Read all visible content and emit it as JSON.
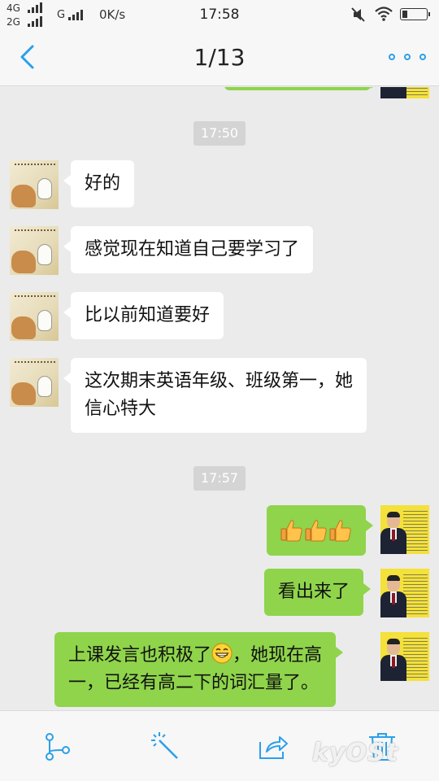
{
  "status_bar": {
    "net1": "4G",
    "net2": "2G",
    "net3": "G",
    "speed": "0K/s",
    "time": "17:58"
  },
  "nav": {
    "title": "1/13",
    "accent_color": "#2aa0e8"
  },
  "chat": {
    "timestamps": [
      "17:50",
      "17:57"
    ],
    "messages": [
      {
        "direction": "in",
        "text": "好的"
      },
      {
        "direction": "in",
        "text": "感觉现在知道自己要学习了"
      },
      {
        "direction": "in",
        "text": "比以前知道要好"
      },
      {
        "direction": "in",
        "line1": "这次期末英语年级、班级第一，她",
        "line2": "信心特大"
      },
      {
        "direction": "out",
        "emoji": [
          "thumbs-up",
          "thumbs-up",
          "thumbs-up"
        ]
      },
      {
        "direction": "out",
        "text": "看出来了"
      },
      {
        "direction": "out",
        "line1_a": "上课发言也积极了",
        "line1_emoji": "grinning-face",
        "line1_b": "，她现在高",
        "line2": "一，已经有高二下的词汇量了。"
      }
    ],
    "bubble_colors": {
      "incoming": "#ffffff",
      "outgoing": "#8fd44b"
    }
  },
  "toolbar": {
    "icons": [
      "branch-icon",
      "magic-wand-icon",
      "share-icon",
      "trash-icon"
    ]
  }
}
